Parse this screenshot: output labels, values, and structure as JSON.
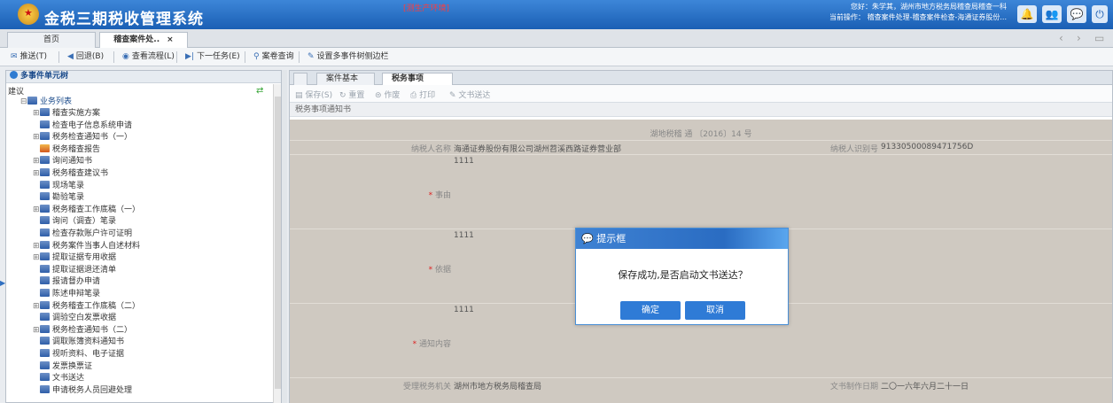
{
  "app": {
    "title": "金税三期税收管理系统",
    "env_label": "[测生产环境]",
    "user_line": "您好：朱学其，湖州市地方税务局稽查局稽查一科",
    "op_line": "当前操作：  稽查案件处理-稽查案件检查-海通证券股份..."
  },
  "header_icons": [
    "bell-icon",
    "users-icon",
    "chat-icon",
    "power-icon"
  ],
  "tabs": [
    {
      "label": "首页"
    },
    {
      "label": "稽查案件处..",
      "close": "×"
    }
  ],
  "nav_arrows": {
    "prev": "‹",
    "next": "›",
    "window": "▭"
  },
  "toolbar": [
    "推送(T)",
    "回退(B)",
    "查看流程(L)",
    "下一任务(E)",
    "案卷查询",
    "设置多事件树侧边栏"
  ],
  "tree": {
    "header": "多事件单元树",
    "root": "建议",
    "group": "业务列表",
    "items": [
      "稽查实施方案",
      "检查电子信息系统申请",
      "税务检查通知书（一）",
      "税务稽查报告",
      "询问通知书",
      "税务稽查建议书",
      "现场笔录",
      "勘验笔录",
      "税务稽查工作底稿（一）",
      "询问（调查）笔录",
      "检查存款账户许可证明",
      "税务案件当事人自述材料",
      "提取证据专用收据",
      "提取证据退还清单",
      "报请督办申请",
      "陈述申辩笔录",
      "税务稽查工作底稿（二）",
      "调验空白发票收据",
      "税务检查通知书（二）",
      "调取账簿资料通知书",
      "视听资料、电子证据",
      "发票换票证",
      "文书送达",
      "申请税务人员回避处理"
    ]
  },
  "right": {
    "tabs": [
      "案件基本信..",
      "税务事项通.."
    ],
    "tab_close": "×",
    "tools": [
      "保存(S)",
      "重置",
      "作废",
      "打印",
      "文书送达"
    ],
    "section": "税务事项通知书",
    "doc": {
      "number": "湖地税稽 通 〔2016〕14 号",
      "taxpayer_label": "纳税人名称",
      "taxpayer": "海通证券股份有限公司湖州苕溪西路证券营业部",
      "taxid_label": "纳税人识别号",
      "taxid": "91330500089471756D",
      "reason_label": "事由",
      "reason": "1111",
      "basis_label": "依据",
      "basis": "1111",
      "notice_label": "通知内容",
      "notice": "1111",
      "org_label": "受理税务机关",
      "org": "湖州市地方税务局稽查局",
      "date_label": "文书制作日期",
      "date": "二〇一六年六月二十一日"
    }
  },
  "modal": {
    "title": "提示框",
    "message": "保存成功,是否启动文书送达？",
    "ok": "确定",
    "cancel": "取消"
  }
}
